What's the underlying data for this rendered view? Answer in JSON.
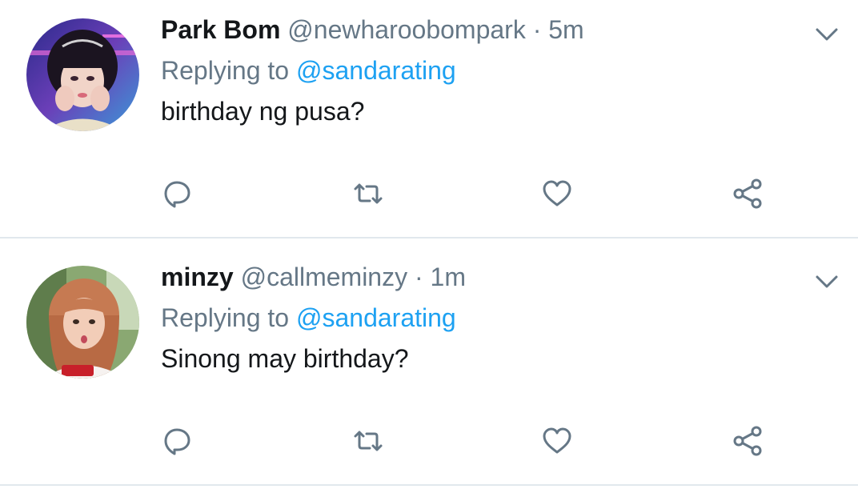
{
  "colors": {
    "text_primary": "#14171a",
    "text_secondary": "#657786",
    "link": "#1da1f2",
    "icon": "#657786",
    "divider": "#e1e8ed"
  },
  "tweets": [
    {
      "display_name": "Park Bom",
      "handle": "@newharoobompark",
      "separator": "·",
      "time": "5m",
      "replying_prefix": "Replying to",
      "replying_to": "@sandarating",
      "text": "birthday ng pusa?",
      "icons": [
        "reply-icon",
        "retweet-icon",
        "like-icon",
        "share-icon",
        "chevron-down-icon"
      ]
    },
    {
      "display_name": "minzy",
      "handle": "@callmeminzy",
      "separator": "·",
      "time": "1m",
      "replying_prefix": "Replying to",
      "replying_to": "@sandarating",
      "text": "Sinong may birthday?",
      "icons": [
        "reply-icon",
        "retweet-icon",
        "like-icon",
        "share-icon",
        "chevron-down-icon"
      ]
    }
  ]
}
